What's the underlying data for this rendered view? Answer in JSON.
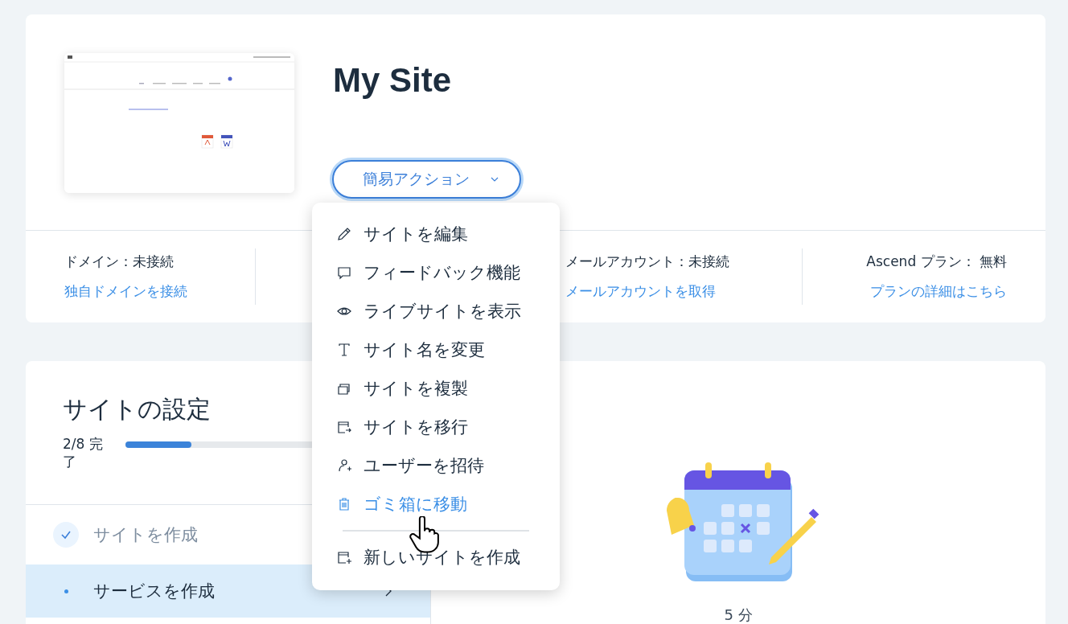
{
  "site": {
    "title": "My Site",
    "quick_actions": {
      "label": "簡易アクション",
      "expanded": true
    }
  },
  "info": [
    {
      "label": "ドメイン：未接続",
      "link": "独自ドメインを接続"
    },
    {
      "label": "メールアカウント：未接続",
      "link": "メールアカウントを取得"
    },
    {
      "label": "Ascend プラン： 無料",
      "link": "プランの詳細はこちら"
    }
  ],
  "menu": {
    "items": [
      {
        "label": "サイトを編集",
        "hovered": false
      },
      {
        "label": "フィードバック機能",
        "hovered": false
      },
      {
        "label": "ライブサイトを表示",
        "hovered": false
      },
      {
        "label": "サイト名を変更",
        "hovered": false
      },
      {
        "label": "サイトを複製",
        "hovered": false
      },
      {
        "label": "サイトを移行",
        "hovered": false
      },
      {
        "label": "ユーザーを招待",
        "hovered": false
      },
      {
        "label": "ゴミ箱に移動",
        "hovered": true
      }
    ],
    "footer_items": [
      {
        "label": "新しいサイトを作成",
        "hovered": false
      }
    ]
  },
  "setup": {
    "title": "サイトの設定",
    "progress_text": "2/8 完了",
    "level": 0.25,
    "steps": [
      {
        "label": "サイトを作成",
        "done": true,
        "selected": false
      },
      {
        "label": "サービスを作成",
        "done": false,
        "selected": true
      }
    ],
    "duration": "5 分"
  }
}
